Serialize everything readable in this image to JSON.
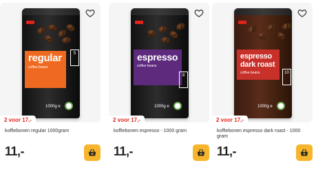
{
  "products": [
    {
      "promo": "2 voor 17,-",
      "name": "koffiebonen regular 1000gram",
      "price": "11,-",
      "pack": {
        "title": "regular",
        "subtitle": "coffee beans",
        "strength": "5",
        "weight": "1000g e",
        "label_color": "#ef6a20"
      }
    },
    {
      "promo": "2 voor 17,-",
      "name": "koffiebonen espresso - 1000 gram",
      "price": "11,-",
      "pack": {
        "title": "espresso",
        "subtitle": "coffee beans",
        "strength": "8",
        "weight": "1000g e",
        "label_color": "#5e2a7e"
      }
    },
    {
      "promo": "2 voor 17,-",
      "name": "koffiebonen espresso dark roast - 1000 gram",
      "price": "11,-",
      "pack": {
        "title": "espresso dark roast",
        "subtitle": "coffee beans",
        "strength": "10",
        "weight": "1000g e",
        "label_color": "#c8302a"
      }
    }
  ],
  "colors": {
    "promo_text": "#e2231a",
    "cart_button": "#f7b52c",
    "price_text": "#222222"
  },
  "icons": {
    "favorite": "heart-outline-icon",
    "cart": "shopping-basket-icon"
  }
}
